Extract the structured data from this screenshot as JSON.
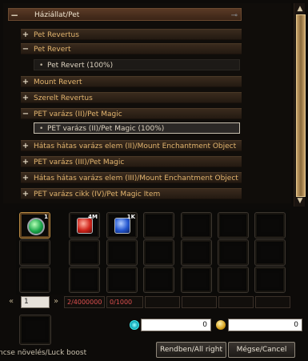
{
  "tree": {
    "root": {
      "sign": "−",
      "label": "Háziállat/Pet"
    },
    "items": [
      {
        "sign": "+",
        "label": "Pet Revertus"
      },
      {
        "sign": "−",
        "label": "Pet Revert"
      },
      {
        "bullet": "•",
        "label": "Pet Revert (100%)"
      },
      {
        "sign": "+",
        "label": "Mount Revert"
      },
      {
        "sign": "+",
        "label": "Szerelt Revertus"
      },
      {
        "sign": "−",
        "label": "PET varázs (II)/Pet Magic"
      },
      {
        "bullet": "•",
        "label": "PET varázs (II)/Pet Magic (100%)"
      },
      {
        "sign": "+",
        "label": "Hátas hátas varázs elem (II)/Mount Enchantment Object"
      },
      {
        "sign": "+",
        "label": "PET varázs (III)/Pet Magic"
      },
      {
        "sign": "+",
        "label": "Hátas hátas varázs elem (III)/Mount Enchantment Object"
      },
      {
        "sign": "+",
        "label": "PET varázs cikk (IV)/Pet Magic Item"
      }
    ]
  },
  "scrollbar": {
    "up": "▲",
    "down": "▼"
  },
  "slots": {
    "main_count": "1",
    "red_count": "4M",
    "blue_count": "1K"
  },
  "pager": {
    "prev": "«",
    "page": "1",
    "next": "»"
  },
  "counters": {
    "red": "2/4000000",
    "blue": "0/1000"
  },
  "luck_label": "ncse növelés/Luck boost",
  "fields": {
    "gem_value": "0",
    "gold_value": "0"
  },
  "buttons": {
    "ok": "Rendben/All right",
    "cancel": "Mégse/Cancel"
  }
}
